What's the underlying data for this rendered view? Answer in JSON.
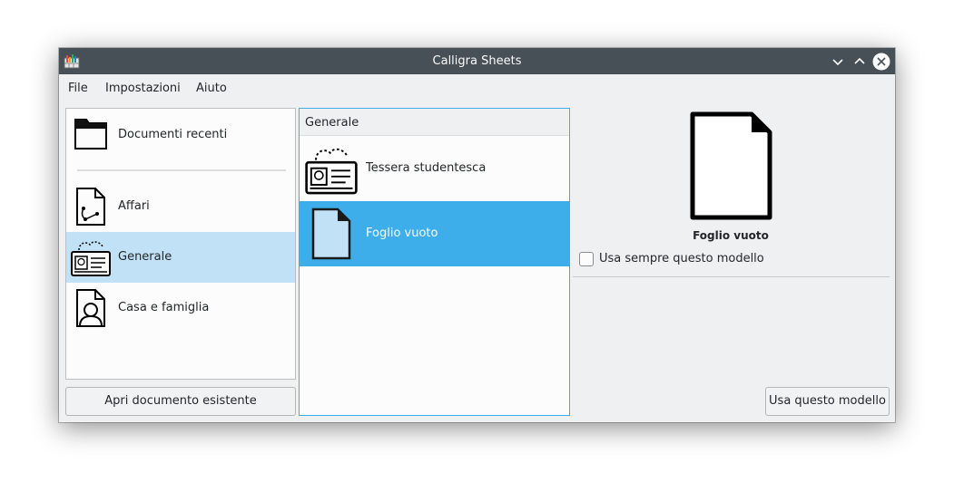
{
  "window": {
    "title": "Calligra Sheets"
  },
  "menubar": {
    "items": [
      "File",
      "Impostazioni",
      "Aiuto"
    ]
  },
  "categories": {
    "recent": "Documenti recenti",
    "items": [
      "Affari",
      "Generale",
      "Casa e famiglia"
    ],
    "selected": "Generale"
  },
  "templates": {
    "header": "Generale",
    "items": [
      "Tessera studentesca",
      "Foglio vuoto"
    ],
    "selected": "Foglio vuoto"
  },
  "preview": {
    "name": "Foglio vuoto",
    "always_use_label": "Usa sempre questo modello",
    "always_use_checked": false
  },
  "buttons": {
    "open_existing": "Apri documento esistente",
    "use_template": "Usa questo modello"
  },
  "colors": {
    "accent": "#3daee9",
    "selection_light": "#c0e1f6",
    "titlebar": "#475057"
  }
}
